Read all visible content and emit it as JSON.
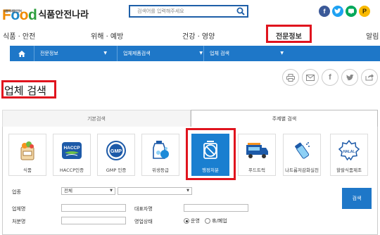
{
  "header": {
    "logo_text": "Food",
    "logo_small": "식품의약품안전처",
    "logo_korean": "식품안전나라",
    "search": {
      "placeholder": "검색어를 입력해주세요",
      "icon": "search-icon"
    },
    "social": [
      {
        "name": "facebook",
        "glyph": "f",
        "color": "#3b5998"
      },
      {
        "name": "twitter",
        "glyph": "t",
        "color": "#1da1f2"
      },
      {
        "name": "blog",
        "glyph": "b",
        "color": "#00a85a"
      },
      {
        "name": "kakaostory",
        "glyph": "P",
        "color": "#f9b900"
      }
    ]
  },
  "nav": {
    "items": [
      "식품 · 안전",
      "위해 · 예방",
      "건강 · 영양",
      "전문정보",
      "알림"
    ],
    "active": "전문정보"
  },
  "breadcrumb": [
    "전문정보",
    "업체제품검색",
    "업체 검색"
  ],
  "tools": [
    "print-icon",
    "mail-icon",
    "facebook-icon",
    "twitter-icon",
    "share-icon"
  ],
  "page_title": "업체 검색",
  "tabs": {
    "basic": "기본검색",
    "topic": "주제별 검색"
  },
  "categories": [
    {
      "label": "식품",
      "icon": "food-bag-icon"
    },
    {
      "label": "HACCP인증",
      "icon": "haccp-icon",
      "text": "HACCP"
    },
    {
      "label": "GMP 인증",
      "icon": "gmp-icon",
      "text": "GMP"
    },
    {
      "label": "위생등급",
      "icon": "hygiene-icon"
    },
    {
      "label": "행정처분",
      "icon": "admin-action-icon",
      "selected": true
    },
    {
      "label": "푸드트럭",
      "icon": "food-truck-icon"
    },
    {
      "label": "나트륨저감화실천",
      "icon": "sodium-icon"
    },
    {
      "label": "할랄식품제조",
      "icon": "halal-icon",
      "text": "HALAL"
    }
  ],
  "form": {
    "industry_label": "업종",
    "industry_value": "전체",
    "industry_sub_value": "",
    "company_label": "업체명",
    "rep_label": "대표자명",
    "office_label": "처분명",
    "status_label": "영업상태",
    "status_options": [
      "운영",
      "휴/폐업"
    ],
    "status_selected": "운영",
    "search_button": "검색"
  },
  "colors": {
    "brand_blue": "#1e77c8",
    "highlight_red": "#e0141e",
    "logo_orange": "#f08a00"
  }
}
